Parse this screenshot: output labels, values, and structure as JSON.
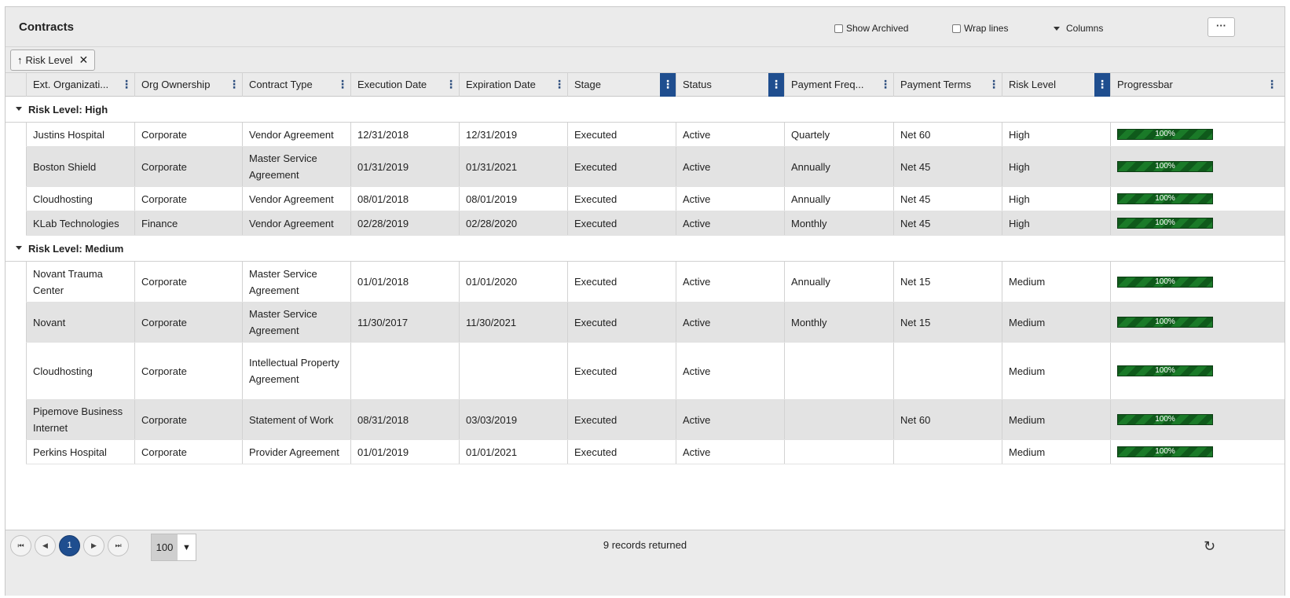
{
  "header": {
    "title": "Contracts",
    "show_archived": "Show Archived",
    "wrap_lines": "Wrap lines",
    "columns": "Columns",
    "more": "···"
  },
  "groupby": {
    "arrow": "↑",
    "label": "Risk Level",
    "remove": "✕"
  },
  "columns": [
    "Ext. Organizati...",
    "Org Ownership",
    "Contract Type",
    "Execution Date",
    "Expiration Date",
    "Stage",
    "Status",
    "Payment Freq...",
    "Payment Terms",
    "Risk Level",
    "Progressbar"
  ],
  "groups": [
    {
      "label": "Risk Level: High",
      "rows": [
        [
          "Justins Hospital",
          "Corporate",
          "Vendor Agreement",
          "12/31/2018",
          "12/31/2019",
          "Executed",
          "Active",
          "Quartely",
          "Net 60",
          "High",
          "100%"
        ],
        [
          "Boston Shield",
          "Corporate",
          "Master Service Agreement",
          "01/31/2019",
          "01/31/2021",
          "Executed",
          "Active",
          "Annually",
          "Net 45",
          "High",
          "100%"
        ],
        [
          "Cloudhosting",
          "Corporate",
          "Vendor Agreement",
          "08/01/2018",
          "08/01/2019",
          "Executed",
          "Active",
          "Annually",
          "Net 45",
          "High",
          "100%"
        ],
        [
          "KLab Technologies",
          "Finance",
          "Vendor Agreement",
          "02/28/2019",
          "02/28/2020",
          "Executed",
          "Active",
          "Monthly",
          "Net 45",
          "High",
          "100%"
        ]
      ]
    },
    {
      "label": "Risk Level: Medium",
      "rows": [
        [
          "Novant Trauma Center",
          "Corporate",
          "Master Service Agreement",
          "01/01/2018",
          "01/01/2020",
          "Executed",
          "Active",
          "Annually",
          "Net 15",
          "Medium",
          "100%"
        ],
        [
          "Novant",
          "Corporate",
          "Master Service Agreement",
          "11/30/2017",
          "11/30/2021",
          "Executed",
          "Active",
          "Monthly",
          "Net 15",
          "Medium",
          "100%"
        ],
        [
          "Cloudhosting",
          "Corporate",
          "Intellectual Property Agreement",
          "",
          "",
          "Executed",
          "Active",
          "",
          "",
          "Medium",
          "100%"
        ],
        [
          "Pipemove Business Internet",
          "Corporate",
          "Statement of Work",
          "08/31/2018",
          "03/03/2019",
          "Executed",
          "Active",
          "",
          "Net 60",
          "Medium",
          "100%"
        ],
        [
          "Perkins Hospital",
          "Corporate",
          "Provider Agreement",
          "01/01/2019",
          "01/01/2021",
          "Executed",
          "Active",
          "",
          "",
          "Medium",
          "100%"
        ]
      ]
    }
  ],
  "footer": {
    "first": "⏮",
    "prev": "◀",
    "current_page": "1",
    "next": "▶",
    "last": "⏭",
    "page_size": "100",
    "page_size_caret": "▼",
    "records": "9 records returned",
    "refresh": "↻"
  },
  "colors": {
    "accent": "#1f4e8f",
    "progress": "#0f5a1b",
    "row_alt": "#e3e3e3",
    "header_bg": "#ebebeb"
  },
  "progress_value": 1.0
}
